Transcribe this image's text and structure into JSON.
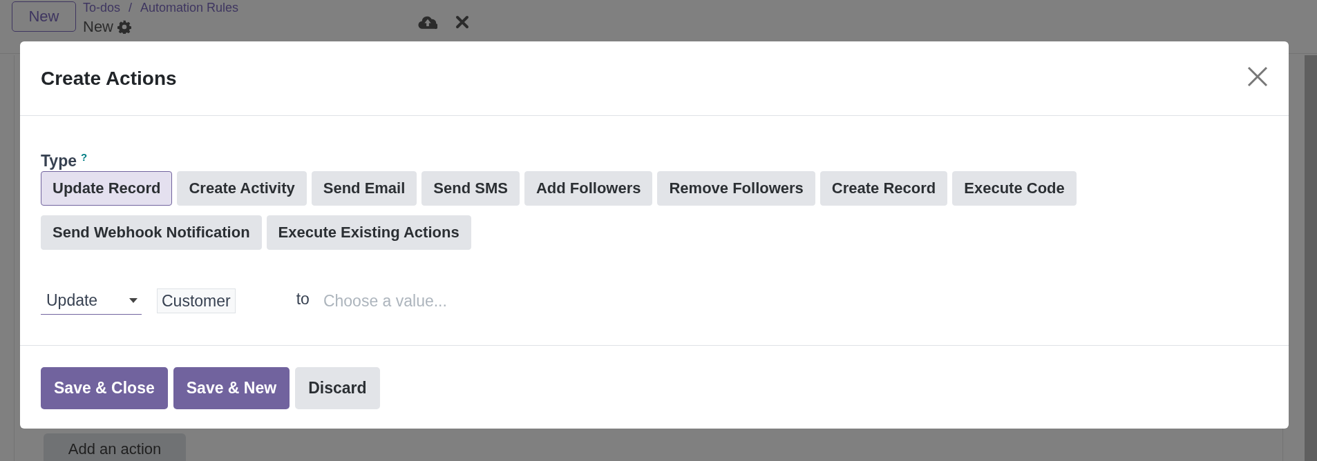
{
  "top_bar": {
    "new_button": "New",
    "breadcrumb": [
      "To-dos",
      "Automation Rules"
    ],
    "separator": "/",
    "record_name": "New"
  },
  "background": {
    "add_action_button": "Add an action"
  },
  "dialog": {
    "title": "Create Actions",
    "type_label": "Type",
    "help_mark": "?",
    "types": [
      {
        "label": "Update Record",
        "selected": true
      },
      {
        "label": "Create Activity",
        "selected": false
      },
      {
        "label": "Send Email",
        "selected": false
      },
      {
        "label": "Send SMS",
        "selected": false
      },
      {
        "label": "Add Followers",
        "selected": false
      },
      {
        "label": "Remove Followers",
        "selected": false
      },
      {
        "label": "Create Record",
        "selected": false
      },
      {
        "label": "Execute Code",
        "selected": false
      },
      {
        "label": "Send Webhook Notification",
        "selected": false
      },
      {
        "label": "Execute Existing Actions",
        "selected": false
      }
    ],
    "update_row": {
      "operation": "Update",
      "field": "Customer",
      "connector": "to",
      "value_placeholder": "Choose a value..."
    },
    "buttons": [
      {
        "label": "Save & Close",
        "kind": "primary"
      },
      {
        "label": "Save & New",
        "kind": "primary"
      },
      {
        "label": "Discard",
        "kind": "secondary"
      }
    ]
  }
}
